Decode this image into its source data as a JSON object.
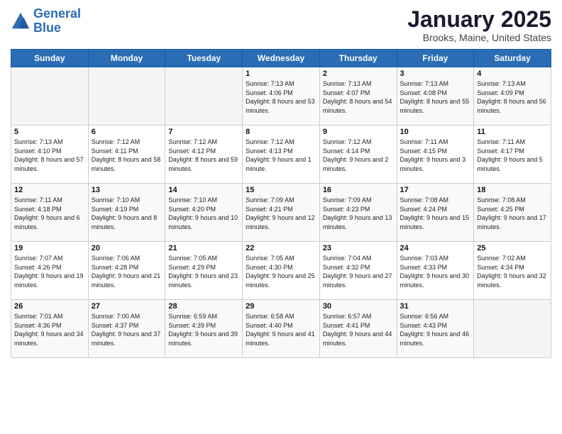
{
  "logo": {
    "line1": "General",
    "line2": "Blue"
  },
  "title": "January 2025",
  "location": "Brooks, Maine, United States",
  "days_header": [
    "Sunday",
    "Monday",
    "Tuesday",
    "Wednesday",
    "Thursday",
    "Friday",
    "Saturday"
  ],
  "weeks": [
    [
      {
        "day": "",
        "info": ""
      },
      {
        "day": "",
        "info": ""
      },
      {
        "day": "",
        "info": ""
      },
      {
        "day": "1",
        "info": "Sunrise: 7:13 AM\nSunset: 4:06 PM\nDaylight: 8 hours\nand 53 minutes."
      },
      {
        "day": "2",
        "info": "Sunrise: 7:13 AM\nSunset: 4:07 PM\nDaylight: 8 hours\nand 54 minutes."
      },
      {
        "day": "3",
        "info": "Sunrise: 7:13 AM\nSunset: 4:08 PM\nDaylight: 8 hours\nand 55 minutes."
      },
      {
        "day": "4",
        "info": "Sunrise: 7:13 AM\nSunset: 4:09 PM\nDaylight: 8 hours\nand 56 minutes."
      }
    ],
    [
      {
        "day": "5",
        "info": "Sunrise: 7:13 AM\nSunset: 4:10 PM\nDaylight: 8 hours\nand 57 minutes."
      },
      {
        "day": "6",
        "info": "Sunrise: 7:12 AM\nSunset: 4:11 PM\nDaylight: 8 hours\nand 58 minutes."
      },
      {
        "day": "7",
        "info": "Sunrise: 7:12 AM\nSunset: 4:12 PM\nDaylight: 8 hours\nand 59 minutes."
      },
      {
        "day": "8",
        "info": "Sunrise: 7:12 AM\nSunset: 4:13 PM\nDaylight: 9 hours\nand 1 minute."
      },
      {
        "day": "9",
        "info": "Sunrise: 7:12 AM\nSunset: 4:14 PM\nDaylight: 9 hours\nand 2 minutes."
      },
      {
        "day": "10",
        "info": "Sunrise: 7:11 AM\nSunset: 4:15 PM\nDaylight: 9 hours\nand 3 minutes."
      },
      {
        "day": "11",
        "info": "Sunrise: 7:11 AM\nSunset: 4:17 PM\nDaylight: 9 hours\nand 5 minutes."
      }
    ],
    [
      {
        "day": "12",
        "info": "Sunrise: 7:11 AM\nSunset: 4:18 PM\nDaylight: 9 hours\nand 6 minutes."
      },
      {
        "day": "13",
        "info": "Sunrise: 7:10 AM\nSunset: 4:19 PM\nDaylight: 9 hours\nand 8 minutes."
      },
      {
        "day": "14",
        "info": "Sunrise: 7:10 AM\nSunset: 4:20 PM\nDaylight: 9 hours\nand 10 minutes."
      },
      {
        "day": "15",
        "info": "Sunrise: 7:09 AM\nSunset: 4:21 PM\nDaylight: 9 hours\nand 12 minutes."
      },
      {
        "day": "16",
        "info": "Sunrise: 7:09 AM\nSunset: 4:23 PM\nDaylight: 9 hours\nand 13 minutes."
      },
      {
        "day": "17",
        "info": "Sunrise: 7:08 AM\nSunset: 4:24 PM\nDaylight: 9 hours\nand 15 minutes."
      },
      {
        "day": "18",
        "info": "Sunrise: 7:08 AM\nSunset: 4:25 PM\nDaylight: 9 hours\nand 17 minutes."
      }
    ],
    [
      {
        "day": "19",
        "info": "Sunrise: 7:07 AM\nSunset: 4:26 PM\nDaylight: 9 hours\nand 19 minutes."
      },
      {
        "day": "20",
        "info": "Sunrise: 7:06 AM\nSunset: 4:28 PM\nDaylight: 9 hours\nand 21 minutes."
      },
      {
        "day": "21",
        "info": "Sunrise: 7:05 AM\nSunset: 4:29 PM\nDaylight: 9 hours\nand 23 minutes."
      },
      {
        "day": "22",
        "info": "Sunrise: 7:05 AM\nSunset: 4:30 PM\nDaylight: 9 hours\nand 25 minutes."
      },
      {
        "day": "23",
        "info": "Sunrise: 7:04 AM\nSunset: 4:32 PM\nDaylight: 9 hours\nand 27 minutes."
      },
      {
        "day": "24",
        "info": "Sunrise: 7:03 AM\nSunset: 4:33 PM\nDaylight: 9 hours\nand 30 minutes."
      },
      {
        "day": "25",
        "info": "Sunrise: 7:02 AM\nSunset: 4:34 PM\nDaylight: 9 hours\nand 32 minutes."
      }
    ],
    [
      {
        "day": "26",
        "info": "Sunrise: 7:01 AM\nSunset: 4:36 PM\nDaylight: 9 hours\nand 34 minutes."
      },
      {
        "day": "27",
        "info": "Sunrise: 7:00 AM\nSunset: 4:37 PM\nDaylight: 9 hours\nand 37 minutes."
      },
      {
        "day": "28",
        "info": "Sunrise: 6:59 AM\nSunset: 4:39 PM\nDaylight: 9 hours\nand 39 minutes."
      },
      {
        "day": "29",
        "info": "Sunrise: 6:58 AM\nSunset: 4:40 PM\nDaylight: 9 hours\nand 41 minutes."
      },
      {
        "day": "30",
        "info": "Sunrise: 6:57 AM\nSunset: 4:41 PM\nDaylight: 9 hours\nand 44 minutes."
      },
      {
        "day": "31",
        "info": "Sunrise: 6:56 AM\nSunset: 4:43 PM\nDaylight: 9 hours\nand 46 minutes."
      },
      {
        "day": "",
        "info": ""
      }
    ]
  ]
}
